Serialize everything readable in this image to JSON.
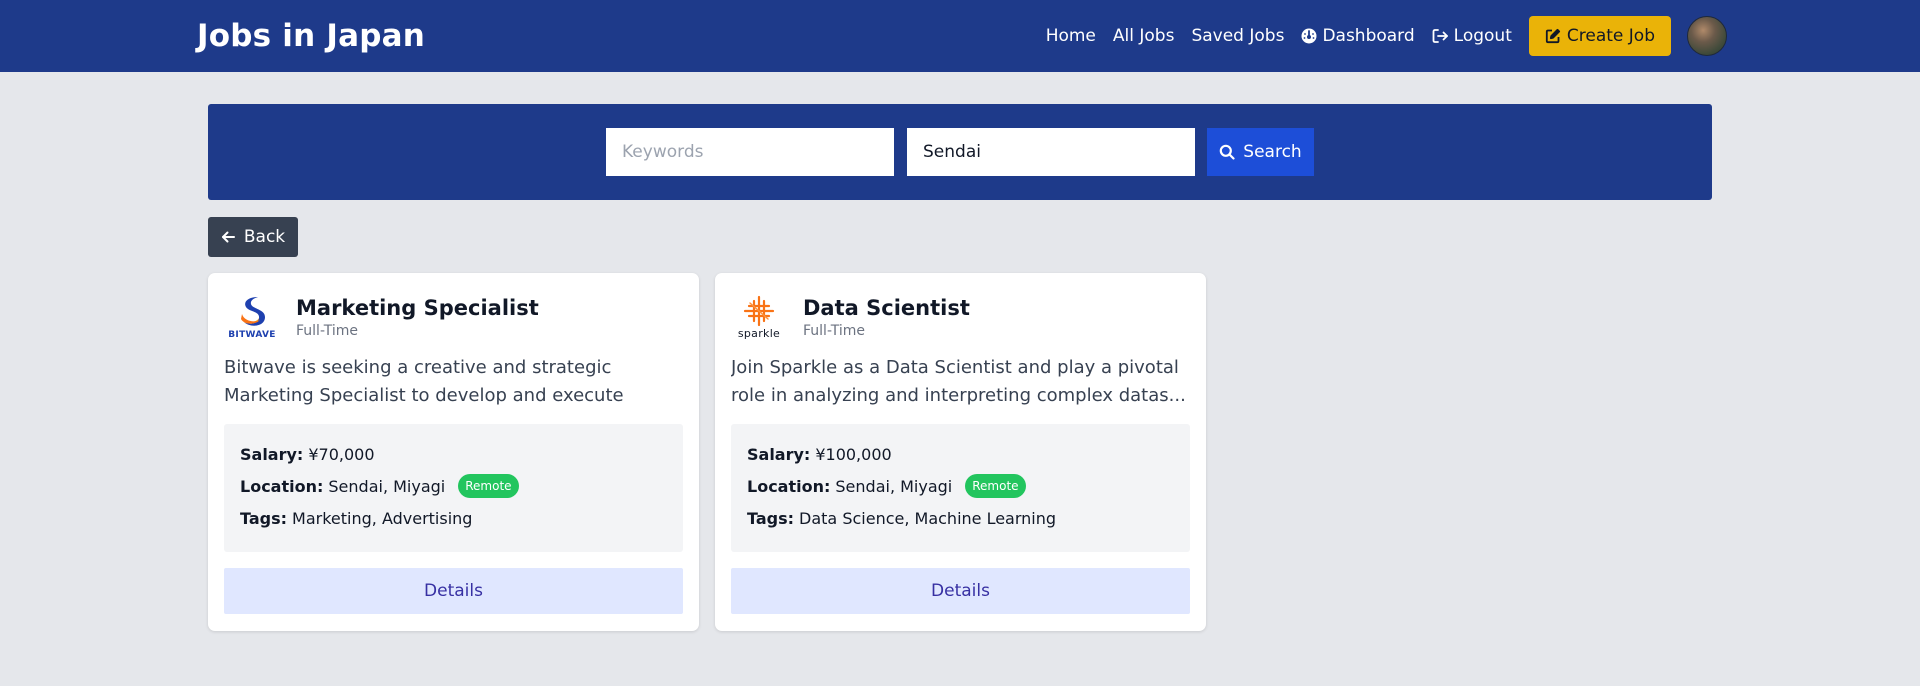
{
  "brand": "Jobs in Japan",
  "nav": {
    "home": "Home",
    "all_jobs": "All Jobs",
    "saved_jobs": "Saved Jobs",
    "dashboard": "Dashboard",
    "logout": "Logout",
    "create_job": "Create Job"
  },
  "search": {
    "keywords_placeholder": "Keywords",
    "keywords_value": "",
    "location_value": "Sendai",
    "button_label": "Search"
  },
  "back_label": "Back",
  "jobs": [
    {
      "logo_name": "BITWAVE",
      "title": "Marketing Specialist",
      "type": "Full-Time",
      "description": "Bitwave is seeking a creative and strategic Marketing Specialist to develop and execute comprehensiv...",
      "salary_label": "Salary:",
      "salary": "¥70,000",
      "location_label": "Location:",
      "location": "Sendai, Miyagi",
      "remote_badge": "Remote",
      "tags_label": "Tags:",
      "tags": "Marketing, Advertising",
      "details_label": "Details"
    },
    {
      "logo_name": "sparkle",
      "title": "Data Scientist",
      "type": "Full-Time",
      "description": "Join Sparkle as a Data Scientist and play a pivotal role in analyzing and interpreting complex datas...",
      "salary_label": "Salary:",
      "salary": "¥100,000",
      "location_label": "Location:",
      "location": "Sendai, Miyagi",
      "remote_badge": "Remote",
      "tags_label": "Tags:",
      "tags": "Data Science, Machine Learning",
      "details_label": "Details"
    }
  ],
  "colors": {
    "navbar": "#1e3a8a",
    "create_button": "#eab308",
    "search_button": "#1d4ed8",
    "back_button": "#374151",
    "remote_badge": "#22c55e",
    "details_button": "#e0e7ff"
  }
}
